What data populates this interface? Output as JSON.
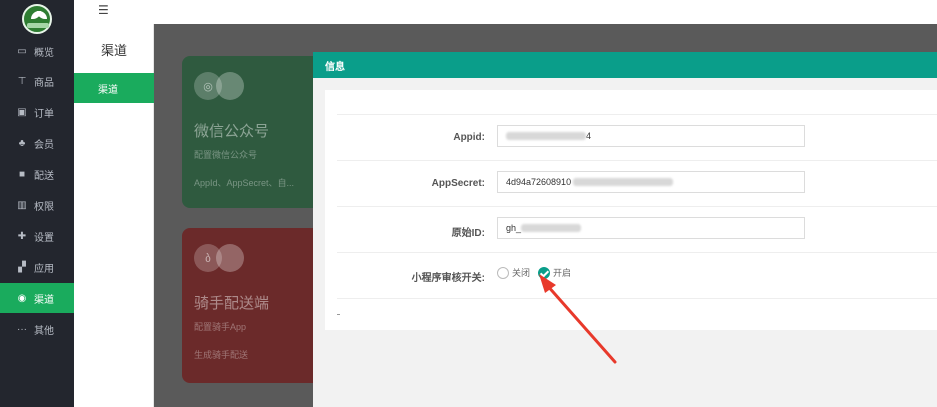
{
  "sidebar": {
    "items": [
      {
        "label": "概览",
        "icon": "monitor-icon"
      },
      {
        "label": "商品",
        "icon": "cart-icon"
      },
      {
        "label": "订单",
        "icon": "order-icon"
      },
      {
        "label": "会员",
        "icon": "members-icon"
      },
      {
        "label": "配送",
        "icon": "truck-icon"
      },
      {
        "label": "权限",
        "icon": "bank-icon"
      },
      {
        "label": "设置",
        "icon": "settings-icon"
      },
      {
        "label": "应用",
        "icon": "apps-icon"
      },
      {
        "label": "渠道",
        "icon": "channel-icon",
        "active": true
      },
      {
        "label": "其他",
        "icon": "more-icon"
      }
    ]
  },
  "subnav": {
    "title": "渠道",
    "item": "渠道"
  },
  "cards": [
    {
      "title": "微信公众号",
      "subtitle": "配置微信公众号",
      "footer": "AppId、AppSecret、自..."
    },
    {
      "title": "骑手配送端",
      "subtitle": "配置骑手App",
      "footer": "生成骑手配送"
    }
  ],
  "dialog": {
    "title": "信息",
    "fields": {
      "appid_label": "Appid:",
      "appid_value": "4",
      "appsecret_label": "AppSecret:",
      "appsecret_value": "4d94a72608910",
      "origin_label": "原始ID:",
      "origin_value": "gh_",
      "switch_label": "小程序审核开关:",
      "switch_off": "关闭",
      "switch_on": "开启",
      "switch_selected": "开启"
    }
  },
  "colors": {
    "sidebar_bg": "#23262e",
    "accent_green": "#1aab5d",
    "dialog_header": "#0a9e8a",
    "annotation_red": "#e8392b"
  }
}
